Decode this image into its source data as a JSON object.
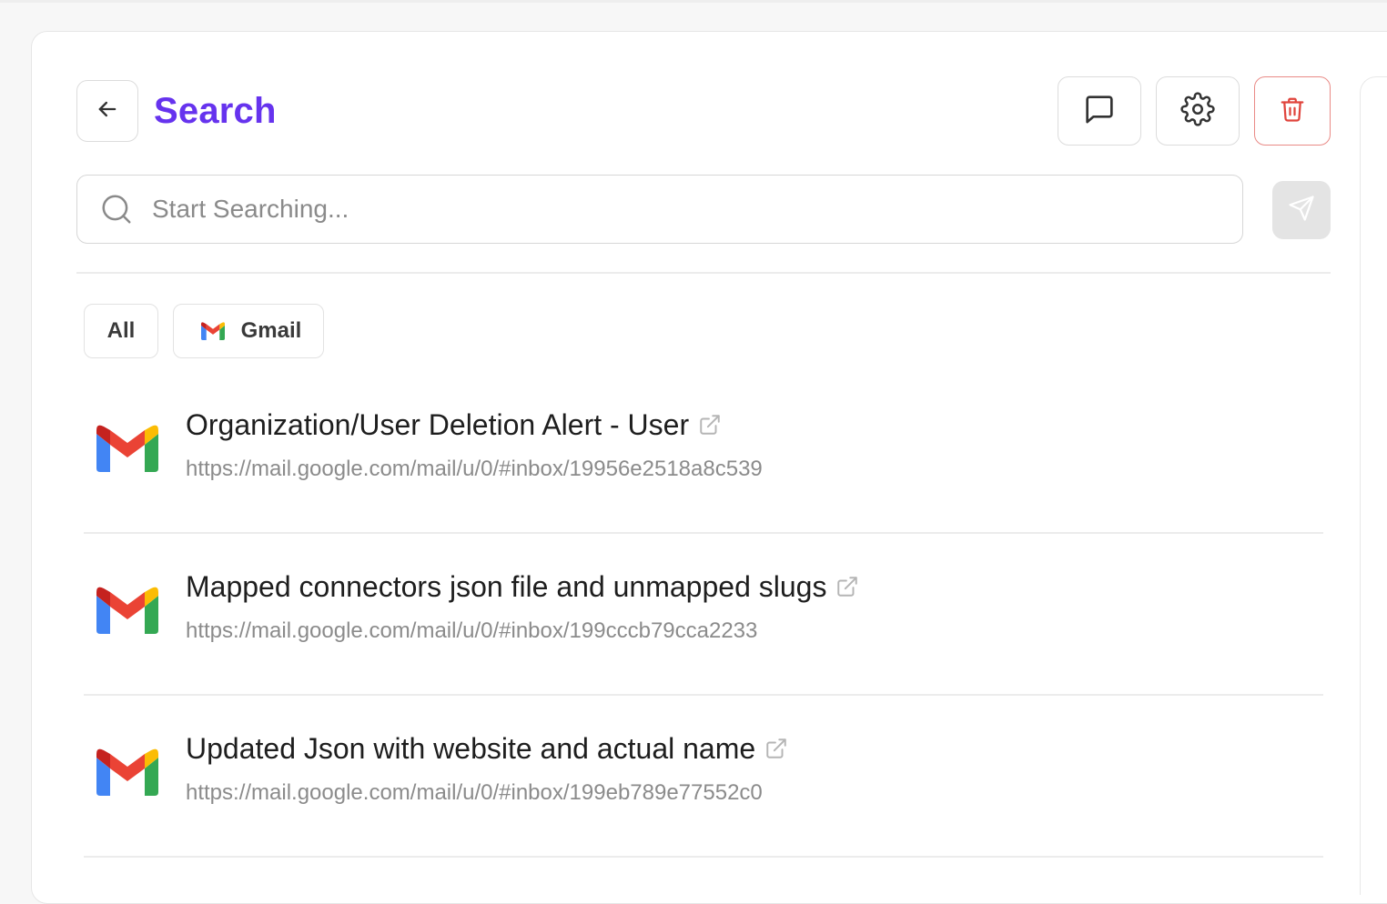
{
  "header": {
    "title": "Search",
    "back_icon": "arrow-left-icon",
    "actions": [
      {
        "name": "chat",
        "icon": "message-square-icon"
      },
      {
        "name": "settings",
        "icon": "gear-icon"
      },
      {
        "name": "delete",
        "icon": "trash-icon",
        "color": "#e0443c"
      }
    ]
  },
  "search": {
    "placeholder": "Start Searching...",
    "value": "",
    "send_icon": "send-icon"
  },
  "filters": [
    {
      "label": "All",
      "selected": false
    },
    {
      "label": "Gmail",
      "icon": "gmail-logo-icon",
      "selected": false
    }
  ],
  "results": [
    {
      "title": "Organization/User Deletion Alert - User",
      "url": "https://mail.google.com/mail/u/0/#inbox/19956e2518a8c539",
      "source_icon": "gmail-logo-icon"
    },
    {
      "title": "Mapped connectors json file and unmapped slugs",
      "url": "https://mail.google.com/mail/u/0/#inbox/199cccb79cca2233",
      "source_icon": "gmail-logo-icon"
    },
    {
      "title": "Updated Json with website and actual name",
      "url": "https://mail.google.com/mail/u/0/#inbox/199eb789e77552c0",
      "source_icon": "gmail-logo-icon"
    }
  ],
  "colors": {
    "accent": "#6633ee",
    "danger": "#e0443c",
    "muted_text": "#8b8b8b",
    "border": "#dcdcdc"
  }
}
